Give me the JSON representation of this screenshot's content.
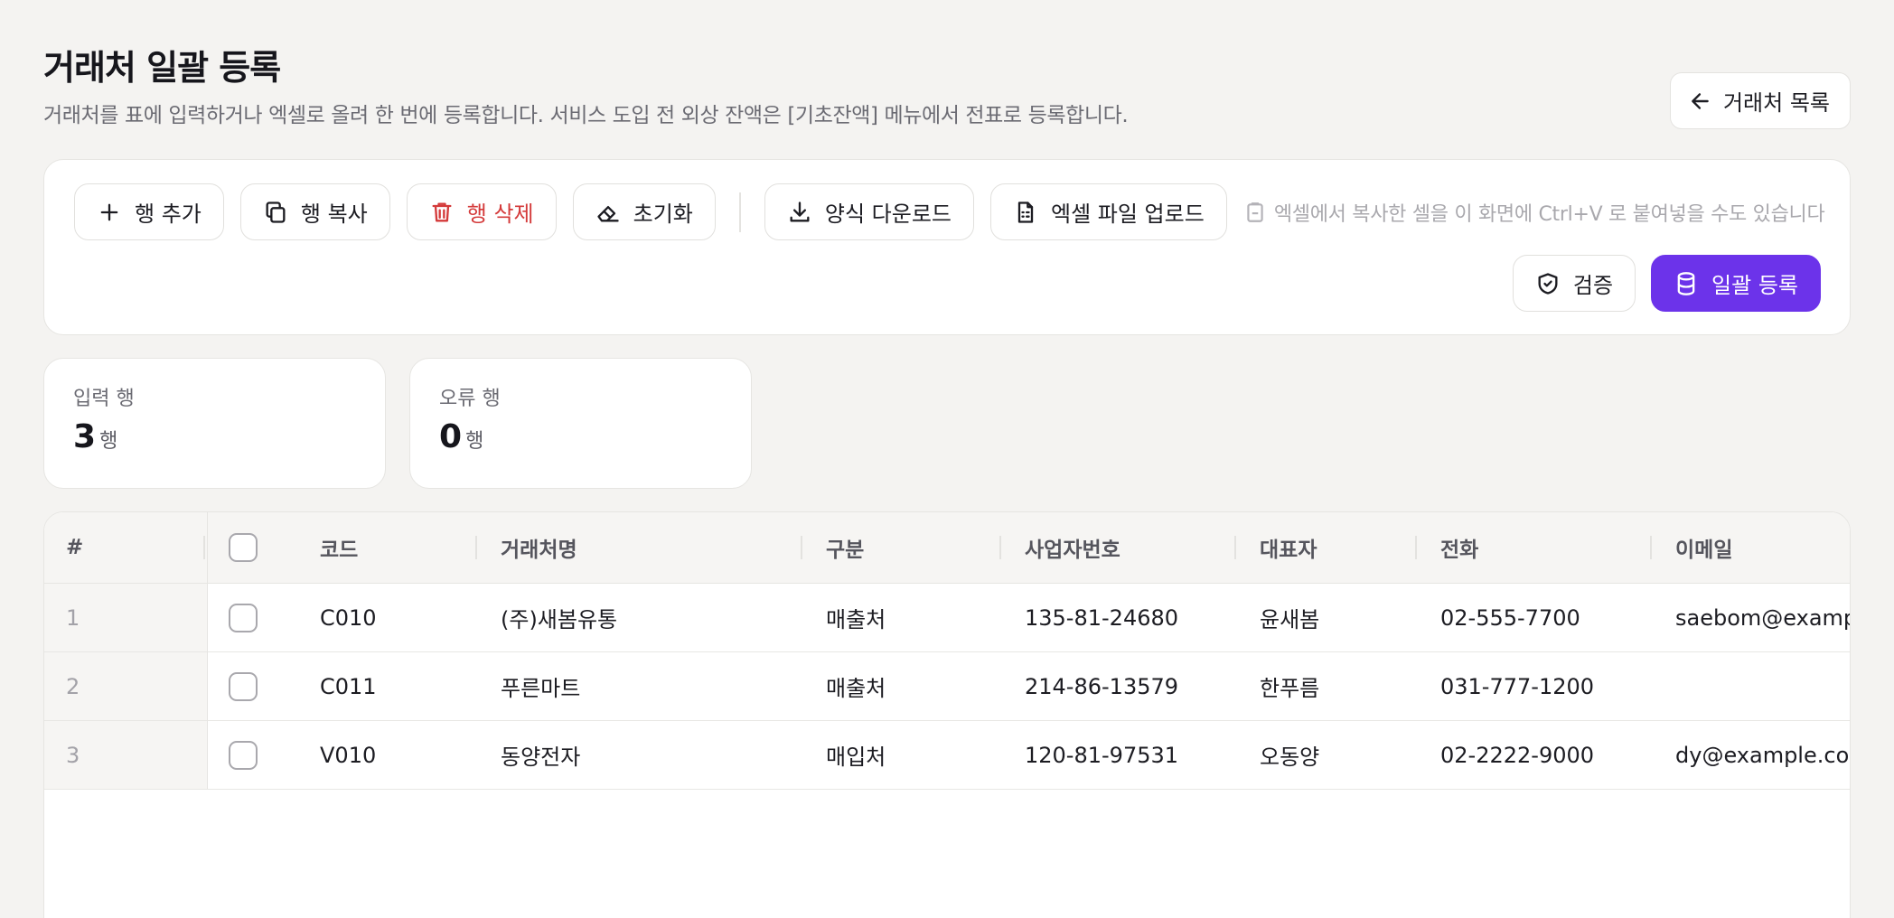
{
  "header": {
    "title": "거래처 일괄 등록",
    "subtitle": "거래처를 표에 입력하거나 엑셀로 올려 한 번에 등록합니다. 서비스 도입 전 외상 잔액은 [기초잔액] 메뉴에서 전표로 등록합니다.",
    "back_label": "거래처 목록"
  },
  "toolbar": {
    "add_row": "행 추가",
    "copy_row": "행 복사",
    "delete_row": "행 삭제",
    "reset": "초기화",
    "download_template": "양식 다운로드",
    "upload_excel": "엑셀 파일 업로드",
    "paste_hint": "엑셀에서 복사한 셀을 이 화면에 Ctrl+V 로 붙여넣을 수도 있습니다",
    "validate": "검증",
    "bulk_register": "일괄 등록"
  },
  "stats": {
    "input_rows": {
      "label": "입력 행",
      "value": "3",
      "unit": "행"
    },
    "error_rows": {
      "label": "오류 행",
      "value": "0",
      "unit": "행"
    }
  },
  "table": {
    "columns": {
      "index": "#",
      "code": "코드",
      "name": "거래처명",
      "type": "구분",
      "biz_no": "사업자번호",
      "ceo": "대표자",
      "phone": "전화",
      "email": "이메일"
    },
    "rows": [
      {
        "index": "1",
        "code": "C010",
        "name": "(주)새봄유통",
        "type": "매출처",
        "biz_no": "135-81-24680",
        "ceo": "윤새봄",
        "phone": "02-555-7700",
        "email": "saebom@examp"
      },
      {
        "index": "2",
        "code": "C011",
        "name": "푸른마트",
        "type": "매출처",
        "biz_no": "214-86-13579",
        "ceo": "한푸름",
        "phone": "031-777-1200",
        "email": ""
      },
      {
        "index": "3",
        "code": "V010",
        "name": "동양전자",
        "type": "매입처",
        "biz_no": "120-81-97531",
        "ceo": "오동양",
        "phone": "02-2222-9000",
        "email": "dy@example.con"
      }
    ]
  },
  "colors": {
    "primary": "#6c33ea",
    "danger": "#d43a3a",
    "background": "#f4f3f1"
  }
}
